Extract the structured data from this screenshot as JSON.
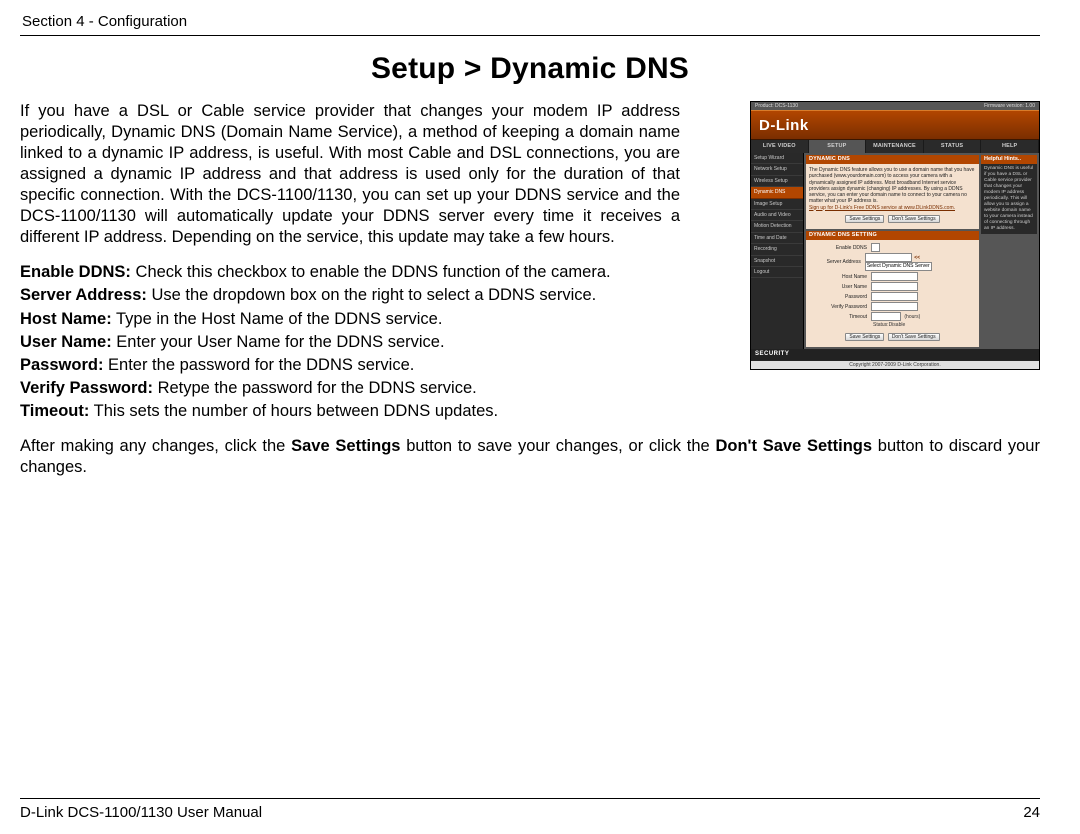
{
  "header": {
    "section": "Section 4 - Configuration"
  },
  "title": "Setup > Dynamic DNS",
  "intro": "If you have a DSL or Cable service provider that changes your modem IP address periodically, Dynamic DNS (Domain Name Service), a method of keeping a domain name linked to a dynamic IP address, is useful. With most Cable and DSL connections, you are assigned a dynamic IP address and that address is used only for the duration of that specific connection. With the DCS-1100/1130, you can set up your DDNS service and the DCS-1100/1130 will automatically update your DDNS server every time it receives a different IP address. Depending on the service, this update may take a few hours.",
  "fields": [
    {
      "label": "Enable DDNS:",
      "desc": " Check this checkbox to enable the DDNS function of the camera."
    },
    {
      "label": "Server Address:",
      "desc": " Use the dropdown box on the right to select a DDNS service."
    },
    {
      "label": "Host Name:",
      "desc": " Type in the Host Name of the DDNS service."
    },
    {
      "label": "User Name:",
      "desc": " Enter your User Name for the DDNS service."
    },
    {
      "label": "Password:",
      "desc": " Enter the password for the DDNS service."
    },
    {
      "label": "Verify Password:",
      "desc": " Retype the password for the DDNS service."
    },
    {
      "label": "Timeout:",
      "desc": " This sets the number of hours between DDNS updates."
    }
  ],
  "closing": {
    "p0": "After making any changes, click the ",
    "b0": "Save Settings",
    "p1": " button to save your changes, or click the ",
    "b1": "Don't Save Settings",
    "p2": " button to discard your changes."
  },
  "footer": {
    "left": "D-Link DCS-1100/1130 User Manual",
    "right": "24"
  },
  "router": {
    "product": "Product: DCS-1130",
    "firmware": "Firmware version: 1.00",
    "brand": "D-Link",
    "nav": [
      "LIVE VIDEO",
      "SETUP",
      "MAINTENANCE",
      "STATUS",
      "HELP"
    ],
    "nav_active": 1,
    "side": [
      "Setup Wizard",
      "Network Setup",
      "Wireless Setup",
      "Dynamic DNS",
      "Image Setup",
      "Audio and Video",
      "Motion Detection",
      "Time and Date",
      "Recording",
      "Snapshot",
      "Logout"
    ],
    "side_sel": 3,
    "panel1": {
      "head": "DYNAMIC DNS",
      "text": "The Dynamic DNS feature allows you to use a domain name that you have purchased (www.yourdomain.com) to access your camera with a dynamically assigned IP address. Most broadband Internet service providers assign dynamic (changing) IP addresses. By using a DDNS service, you can enter your domain name to connect to your camera no matter what your IP address is.",
      "signup": "Sign up for D-Link's Free DDNS service at www.DLinkDDNS.com.",
      "save": "Save Settings",
      "dont": "Don't Save Settings"
    },
    "panel2": {
      "head": "DYNAMIC DNS SETTING",
      "rows": {
        "enable": "Enable DDNS",
        "server": "Server Address",
        "select": "Select Dynamic DNS Server",
        "host": "Host Name",
        "user": "User Name",
        "pass": "Password",
        "verify": "Verify Password",
        "timeout": "Timeout",
        "timeout_unit": "(hours)",
        "status": "Status:Disable"
      }
    },
    "help": {
      "head": "Helpful Hints..",
      "text": "Dynamic DNS is useful if you have a DSL or Cable service provider that changes your modem IP address periodically. This will allow you to assign a website domain name to your camera instead of connecting through an IP address."
    },
    "security": "SECURITY",
    "copyright": "Copyright 2007-2009 D-Link Corporation."
  }
}
